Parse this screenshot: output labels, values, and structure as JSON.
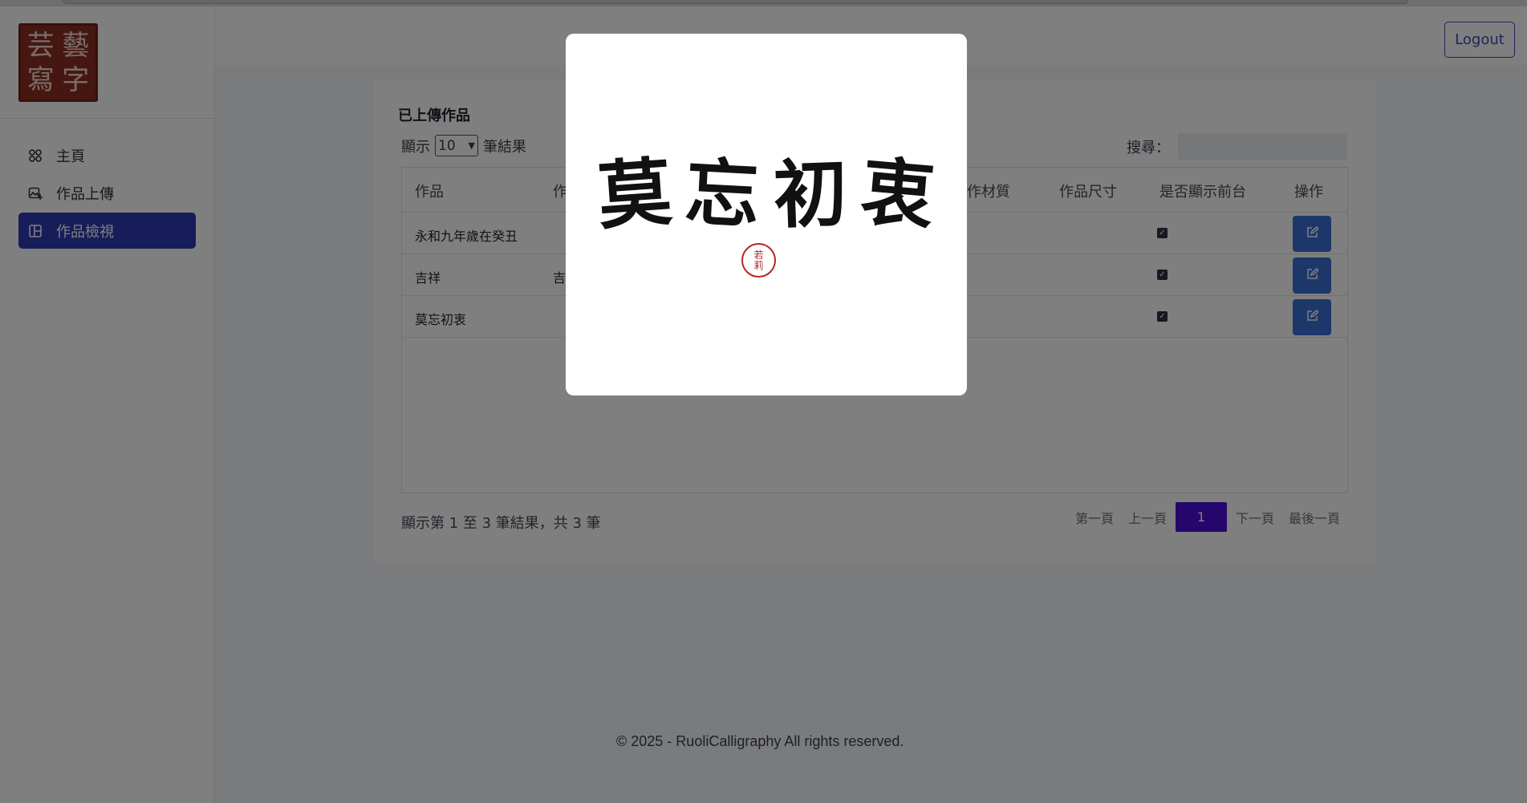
{
  "logo": {
    "chars": [
      "芸",
      "藝",
      "寫",
      "字"
    ]
  },
  "sidebar": {
    "items": [
      {
        "label": "主頁",
        "icon": "home-icon"
      },
      {
        "label": "作品上傳",
        "icon": "image-upload-icon"
      },
      {
        "label": "作品檢視",
        "icon": "layout-icon",
        "active": true
      }
    ]
  },
  "header": {
    "logout_label": "Logout"
  },
  "main": {
    "title": "已上傳作品",
    "length": {
      "prefix": "顯示",
      "value": "10",
      "suffix": "筆結果"
    },
    "search_label": "搜尋：",
    "columns": [
      "作品",
      "作",
      "創作材質",
      "作品尺寸",
      "是否顯示前台",
      "操作"
    ],
    "rows": [
      {
        "name": "永和九年歲在癸丑",
        "col2": "",
        "show": true
      },
      {
        "name": "吉祥",
        "col2": "吉",
        "show": true
      },
      {
        "name": "莫忘初衷",
        "col2": "",
        "show": true
      }
    ],
    "info": "顯示第 1 至 3 筆結果，共 3 筆",
    "pager": {
      "first": "第一頁",
      "prev": "上一頁",
      "current": "1",
      "next": "下一頁",
      "last": "最後一頁"
    }
  },
  "footer": {
    "text": "© 2025 - RuoliCalligraphy All rights reserved."
  },
  "modal": {
    "artwork_chars": [
      "莫",
      "忘",
      "初",
      "衷"
    ],
    "seal_chars": [
      "若",
      "莉"
    ]
  },
  "colors": {
    "accent": "#2e3ab3",
    "pager_active": "#4a0fd9",
    "edit_button": "#3d6fd6",
    "seal": "#b02a24"
  }
}
